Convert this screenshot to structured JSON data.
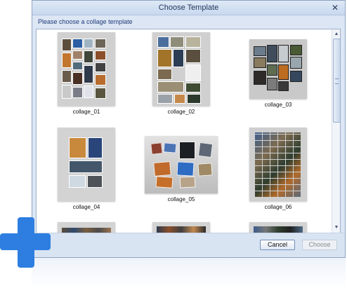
{
  "dialog": {
    "title": "Choose Template",
    "close_label": "✕",
    "prompt": "Please choose a collage template"
  },
  "templates": [
    {
      "name": "collage_01"
    },
    {
      "name": "collage_02"
    },
    {
      "name": "collage_03"
    },
    {
      "name": "collage_04"
    },
    {
      "name": "collage_05"
    },
    {
      "name": "collage_06"
    }
  ],
  "buttons": {
    "cancel": "Cancel",
    "choose": "Choose"
  },
  "colors": {
    "accent": "#2d7ee0",
    "title_text": "#1d3557"
  }
}
